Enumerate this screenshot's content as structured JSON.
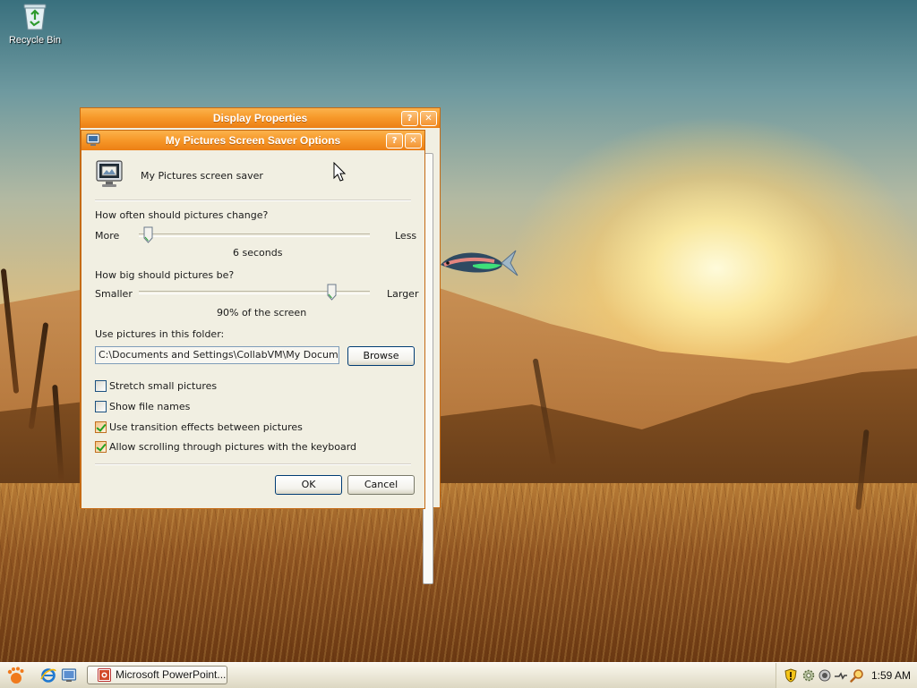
{
  "desktop": {
    "recycle_bin_label": "Recycle Bin",
    "icons": [
      "recycle-bin-icon",
      "fish-icon",
      "pointer-cursor-icon"
    ]
  },
  "display_properties": {
    "title": "Display Properties",
    "help_button": "?",
    "close_button": "✕"
  },
  "screensaver_options": {
    "title": "My Pictures Screen Saver Options",
    "help_button": "?",
    "close_button": "✕",
    "header_text": "My Pictures screen saver",
    "change_question": "How often should pictures change?",
    "change_min_label": "More",
    "change_max_label": "Less",
    "change_value_text": "6 seconds",
    "change_slider_level": 0.02,
    "size_question": "How big should pictures be?",
    "size_min_label": "Smaller",
    "size_max_label": "Larger",
    "size_value_text": "90% of the screen",
    "size_slider_level": 0.85,
    "folder_label": "Use pictures in this folder:",
    "folder_path": "C:\\Documents and Settings\\CollabVM\\My Documents\\",
    "browse_button": "Browse",
    "checkboxes": [
      {
        "label": "Stretch small pictures",
        "checked": false
      },
      {
        "label": "Show file names",
        "checked": false
      },
      {
        "label": "Use transition effects between pictures",
        "checked": true
      },
      {
        "label": "Allow scrolling through pictures with the keyboard",
        "checked": true
      }
    ],
    "ok_button": "OK",
    "cancel_button": "Cancel"
  },
  "taskbar": {
    "start_icon": "gnome-foot-icon",
    "quick_launch": [
      "internet-explorer-icon",
      "show-desktop-icon"
    ],
    "task_button_label": "Microsoft PowerPoint...",
    "tray_icons": [
      "security-shield-icon",
      "settings-gear-icon",
      "volume-icon",
      "network-icon",
      "search-icon"
    ],
    "clock": "1:59 AM"
  },
  "colors": {
    "titlebar_orange": "#f79a2b",
    "dialog_bg": "#f1efe2",
    "checkbox_check": "#21a121"
  }
}
